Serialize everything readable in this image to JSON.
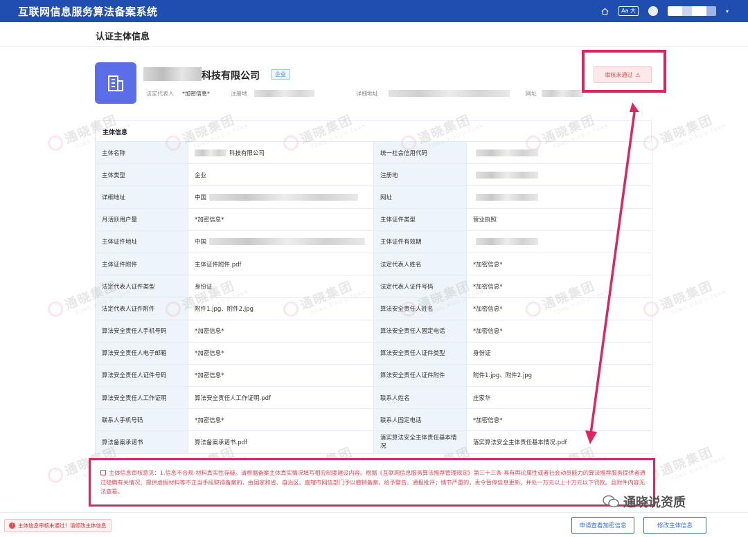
{
  "app": {
    "title": "互联网信息服务算法备案系统"
  },
  "topbar": {
    "aa_label": "Aa 大"
  },
  "page": {
    "title": "认证主体信息"
  },
  "company": {
    "name_suffix": "科技有限公司",
    "tag": "企业",
    "meta": {
      "legal_rep_label": "法定代表人",
      "legal_rep_value": "*加密信息*",
      "reg_place_label": "注册地",
      "address_label": "详细地址",
      "website_label": "网址"
    },
    "status": "审核未通过"
  },
  "section": {
    "title": "主体信息"
  },
  "table": {
    "rows": [
      {
        "l1": "主体名称",
        "v1": "科技有限公司",
        "l2": "统一社会信用代码",
        "v2": ""
      },
      {
        "l1": "主体类型",
        "v1": "企业",
        "l2": "注册地",
        "v2": ""
      },
      {
        "l1": "详细地址",
        "v1": "中国",
        "l2": "网址",
        "v2": ""
      },
      {
        "l1": "月活跃用户量",
        "v1": "*加密信息*",
        "l2": "主体证件类型",
        "v2": "营业执照"
      },
      {
        "l1": "主体证件地址",
        "v1": "中国",
        "l2": "主体证件有效期",
        "v2": ""
      },
      {
        "l1": "主体证件附件",
        "v1": "主体证件附件.pdf",
        "l2": "法定代表人姓名",
        "v2": "*加密信息*"
      },
      {
        "l1": "法定代表人证件类型",
        "v1": "身份证",
        "l2": "法定代表人证件号码",
        "v2": "*加密信息*"
      },
      {
        "l1": "法定代表人证件附件",
        "v1": "附件1.jpg、附件2.jpg",
        "l2": "算法安全责任人姓名",
        "v2": "*加密信息*"
      },
      {
        "l1": "算法安全责任人手机号码",
        "v1": "*加密信息*",
        "l2": "算法安全责任人固定电话",
        "v2": "*加密信息*"
      },
      {
        "l1": "算法安全责任人电子邮箱",
        "v1": "*加密信息*",
        "l2": "算法安全责任人证件类型",
        "v2": "身份证"
      },
      {
        "l1": "算法安全责任人证件号码",
        "v1": "*加密信息*",
        "l2": "算法安全责任人证件附件",
        "v2": "附件1.jpg、附件2.jpg"
      },
      {
        "l1": "算法安全责任人工作证明",
        "v1": "算法安全责任人工作证明.pdf",
        "l2": "联系人姓名",
        "v2": "庄家华"
      },
      {
        "l1": "联系人手机号码",
        "v1": "*加密信息*",
        "l2": "联系人固定电话",
        "v2": "*加密信息*"
      },
      {
        "l1": "算法备案承诺书",
        "v1": "算法备案承诺书.pdf",
        "l2": "落实算法安全主体责任基本情况",
        "v2": "落实算法安全主体责任基本情况.pdf"
      }
    ]
  },
  "opinion": {
    "text": "主体信息审核意见：1.信息不合规-材料真实性存疑。请根据备案主体真实情况填写相应制度建设内容。根据《互联网信息服务算法推荐管理规定》第三十三条 具有舆论属性或者社会动员能力的算法推荐服务提供者通过隐瞒有关情况、提供虚假材料等不正当手段取得备案的，由国家和省、自治区、直辖市网信部门予以撤销备案，给予警告、通报批评；情节严重的，责令暂停信息更新，并处一万元以上十万元以下罚款。且附件内容无法查看。"
  },
  "bottom": {
    "alert": "主体信息审核未通过！请修改主体信息",
    "apply_button": "申请查看加密信息",
    "edit_button": "修改主体信息"
  },
  "watermark": {
    "cn": "通晓集团",
    "en": "TONG XIAO JI TUAN"
  },
  "footer_mark": {
    "text": "通晓说资质"
  },
  "colors": {
    "topbar": "#1f4eb0",
    "highlight": "#e0245e",
    "status_red": "#e15050",
    "label_bg": "#edf5fb",
    "accent": "#3b6fd8"
  }
}
